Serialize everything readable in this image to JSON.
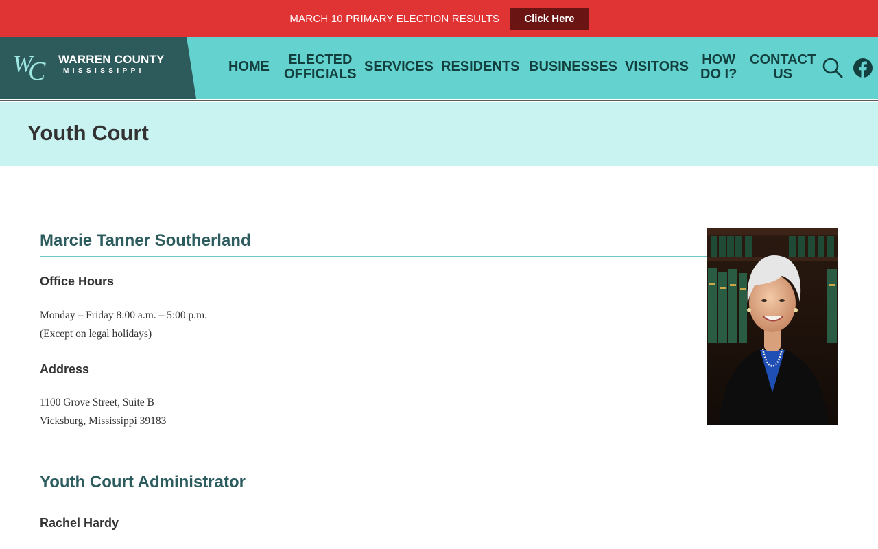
{
  "alert": {
    "text": "MARCH 10 PRIMARY ELECTION RESULTS",
    "button_label": "Click Here"
  },
  "logo": {
    "monogram": "WC",
    "name": "WARREN COUNTY",
    "state": "MISSISSIPPI"
  },
  "nav": {
    "home": "HOME",
    "elected_1": "ELECTED",
    "elected_2": "OFFICIALS",
    "services": "SERVICES",
    "residents": "RESIDENTS",
    "businesses": "BUSINESSES",
    "visitors": "VISITORS",
    "how_1": "HOW",
    "how_2": "DO I?",
    "contact_1": "CONTACT",
    "contact_2": "US"
  },
  "icons": {
    "search": "search-icon",
    "facebook": "facebook-icon"
  },
  "page": {
    "title": "Youth Court"
  },
  "judge": {
    "name": "Marcie Tanner Southerland",
    "office_hours_heading": "Office Hours",
    "hours_line1": "Monday – Friday 8:00 a.m. – 5:00 p.m.",
    "hours_line2": "(Except on legal holidays)",
    "address_heading": "Address",
    "address_line1": "1100 Grove Street, Suite B",
    "address_line2": "Vicksburg, Mississippi 39183"
  },
  "administrator": {
    "heading": "Youth Court Administrator",
    "name": "Rachel Hardy"
  },
  "colors": {
    "alert_bg": "#e03434",
    "alert_button_bg": "#6b1414",
    "header_bg": "#64d2cf",
    "logo_bg": "#2d5a5a",
    "title_band_bg": "#c9f3f1",
    "heading_color": "#2d5c5e"
  }
}
